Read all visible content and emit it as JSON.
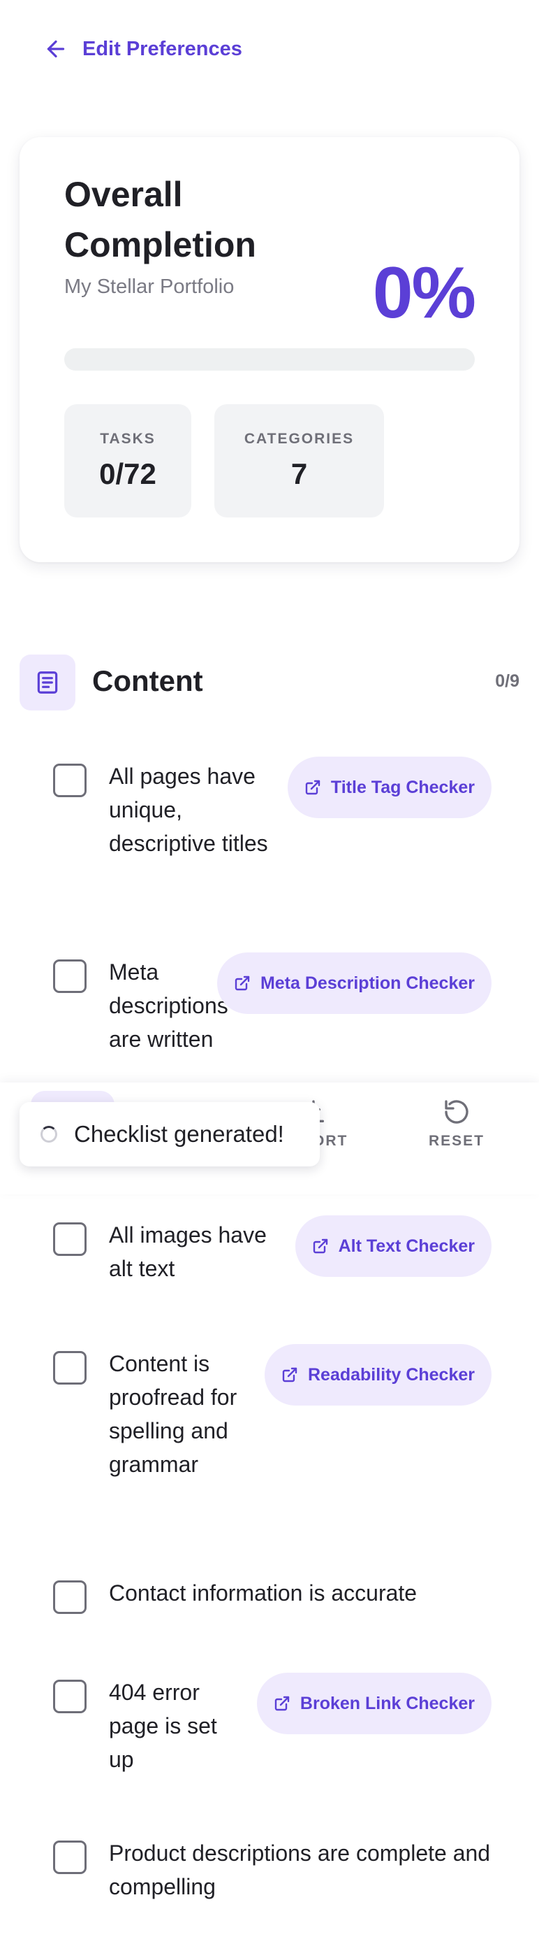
{
  "nav": {
    "back_label": "Edit Preferences"
  },
  "summary": {
    "title": "Overall Completion",
    "project_name": "My Stellar Portfolio",
    "percent_label": "0%",
    "progress_fraction": 0,
    "stats": [
      {
        "label": "TASKS",
        "value": "0/72"
      },
      {
        "label": "CATEGORIES",
        "value": "7"
      }
    ]
  },
  "category": {
    "title": "Content",
    "count": "0/9",
    "icon": "document-icon",
    "tasks": [
      {
        "text": "All pages have unique, descriptive titles",
        "tool": "Title Tag Checker"
      },
      {
        "text": "Meta descriptions are written",
        "tool": "Meta Description Checker"
      },
      {
        "text": "All images have alt text",
        "tool": "Alt Text Checker"
      },
      {
        "text": "Content is proofread for spelling and grammar",
        "tool": "Readability Checker"
      },
      {
        "text": "Contact information is accurate",
        "tool": null
      },
      {
        "text": "404 error page is set up",
        "tool": "Broken Link Checker"
      },
      {
        "text": "Product descriptions are complete and compelling",
        "tool": null
      }
    ]
  },
  "toolbar": {
    "export_label": "EXPORT",
    "reset_label": "RESET"
  },
  "toast": {
    "message": "Checklist generated!"
  },
  "colors": {
    "accent": "#5b3fd6",
    "accent_soft": "#efeafd"
  }
}
